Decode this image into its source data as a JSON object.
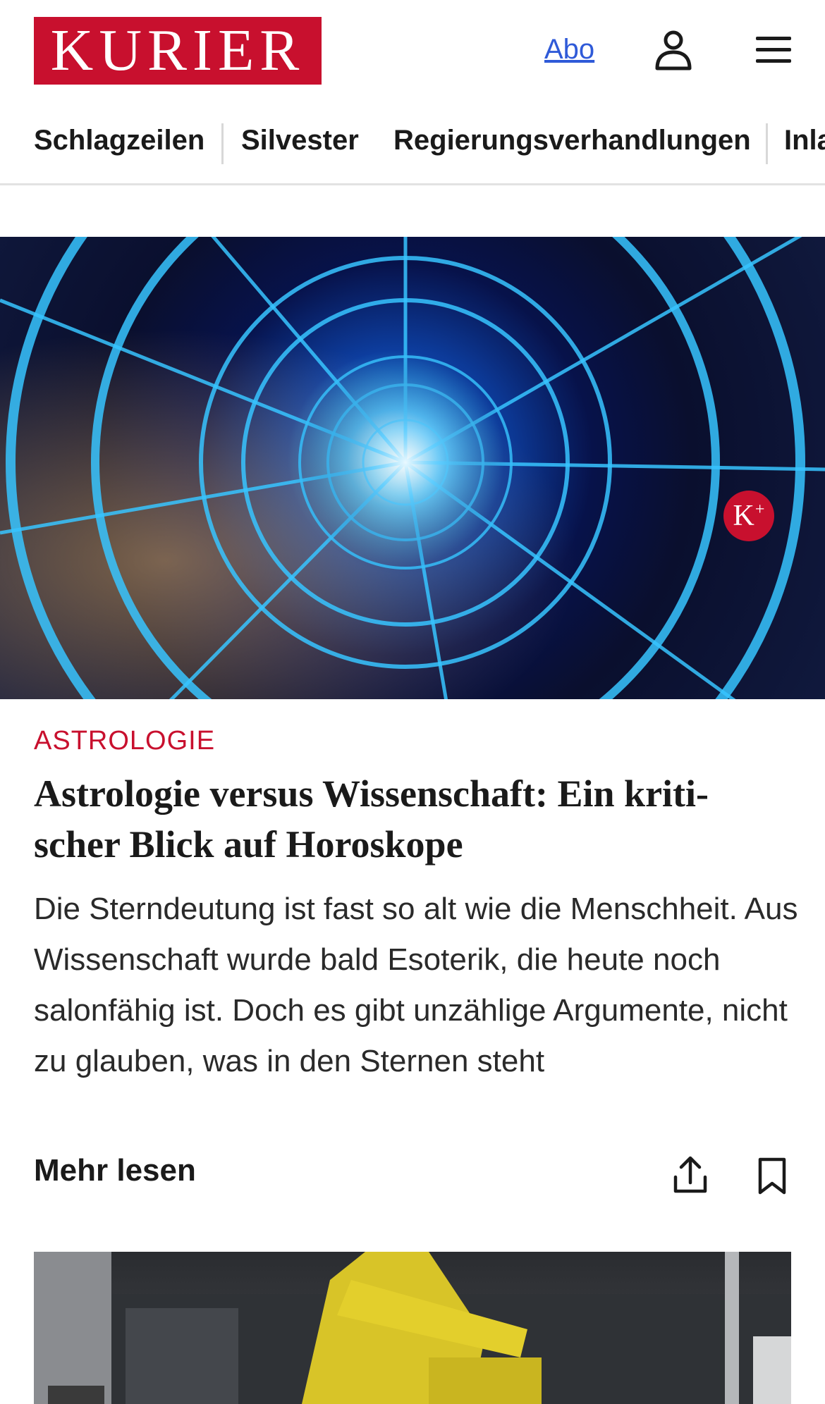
{
  "header": {
    "logo_text": "KURIER",
    "abo_label": "Abo",
    "user_icon": "user-icon",
    "menu_icon": "hamburger-menu-icon",
    "brand_color": "#c8102e",
    "link_color": "#2f5ad8"
  },
  "nav": {
    "items": [
      {
        "label": "Schlagzeilen"
      },
      {
        "label": "Silvester"
      },
      {
        "label": "Regierungsverhandlungen"
      },
      {
        "label": "Inla"
      }
    ]
  },
  "article": {
    "badge": "K+",
    "category": "ASTROLOGIE",
    "headline_line1": "Astrologie versus Wissenschaft: Ein kriti-",
    "headline_line2": "scher Blick auf Horoskope",
    "teaser": "Die Sterndeutung ist fast so alt wie die Menschheit. Aus Wissenschaft wurde bald Esoterik, die heute noch salonfähig ist. Doch es gibt unzählige Argumente, nicht zu glauben, was in den Sternen steht",
    "more_label": "Mehr lesen",
    "share_icon": "share-icon",
    "bookmark_icon": "bookmark-icon"
  },
  "second_article": {
    "image_icon": "excavator-photo"
  }
}
